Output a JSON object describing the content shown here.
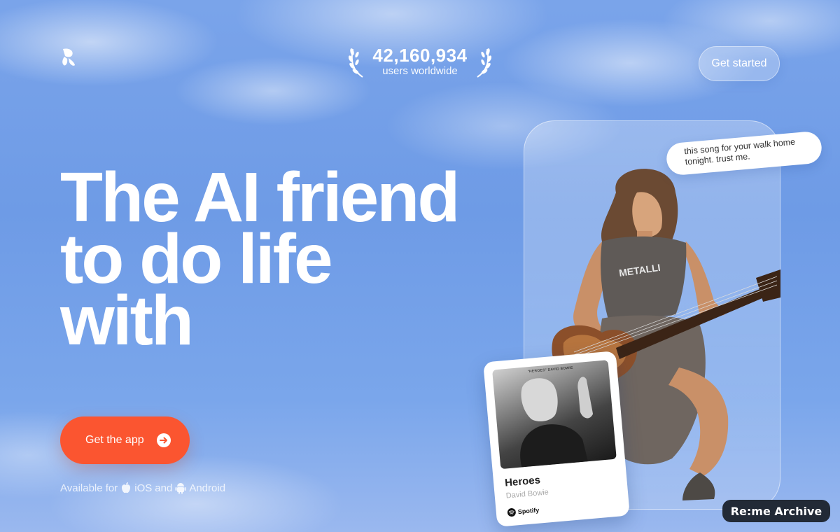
{
  "brand": {
    "logo_icon": "reme-logo-icon"
  },
  "stats": {
    "user_count": "42,160,934",
    "user_label": "users worldwide"
  },
  "header": {
    "get_started_label": "Get started"
  },
  "hero": {
    "headline_lines": [
      "The AI friend",
      "to do life",
      "with"
    ],
    "cta_label": "Get the app",
    "availability": {
      "prefix": "Available for",
      "ios": "iOS",
      "and": "and",
      "android": "Android"
    }
  },
  "chat_bubble": {
    "text": "this song for your walk home tonight. trust me."
  },
  "song_card": {
    "cover_title": "\"HEROES\" DAVID BOWIE",
    "title": "Heroes",
    "artist": "David Bowie",
    "service": "Spotify"
  },
  "watermark": {
    "label": "Re:me Archive"
  },
  "colors": {
    "cta": "#fb5530",
    "sky": "#6e9be6",
    "badge": "#222a36"
  }
}
